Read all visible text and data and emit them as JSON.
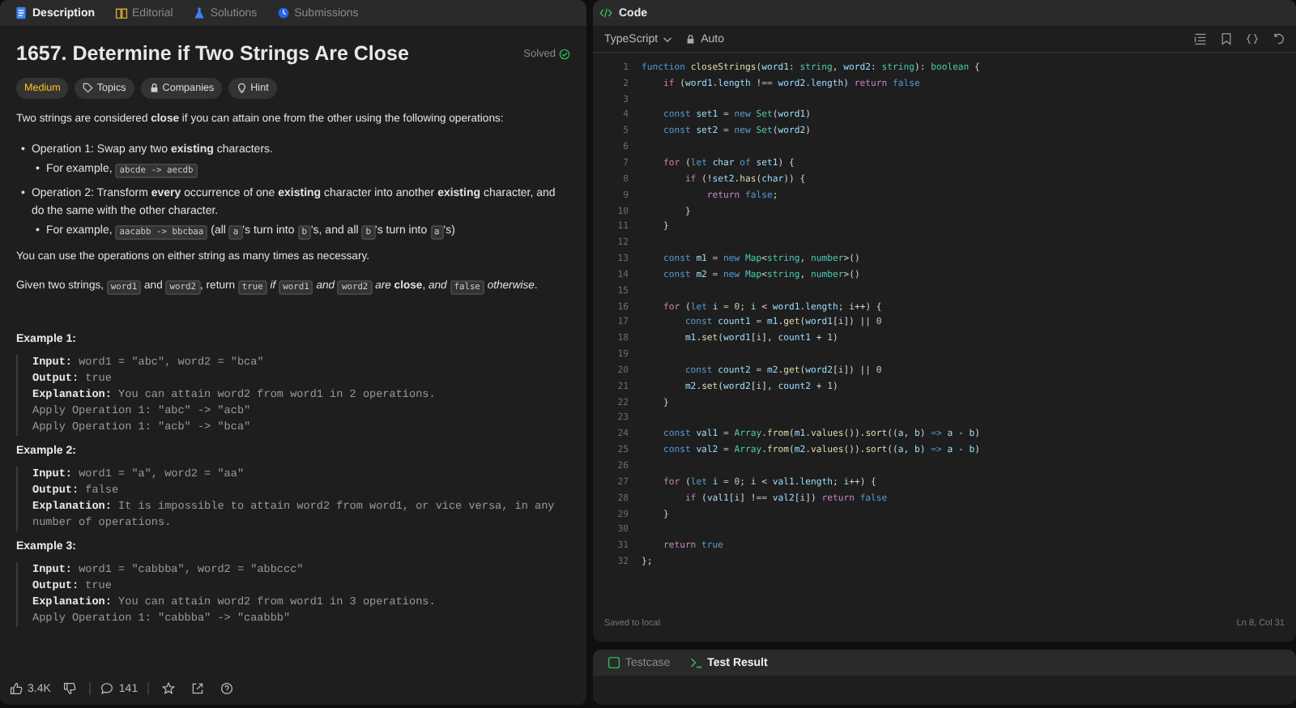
{
  "problem_panel": {
    "tabs": [
      {
        "label": "Description",
        "selected": true,
        "kind": "doc"
      },
      {
        "label": "Editorial",
        "selected": false,
        "kind": "book"
      },
      {
        "label": "Solutions",
        "selected": false,
        "kind": "flask"
      },
      {
        "label": "Submissions",
        "selected": false,
        "kind": "clock"
      }
    ],
    "title": "1657. Determine if Two Strings Are Close",
    "status": "Solved",
    "badges": [
      {
        "label": "Medium",
        "kind": "difficulty"
      },
      {
        "label": "Topics",
        "kind": "tag"
      },
      {
        "label": "Companies",
        "kind": "lock"
      },
      {
        "label": "Hint",
        "kind": "bulb"
      }
    ],
    "description": [
      {
        "kind": "p",
        "segments": [
          {
            "kind": "text",
            "text": "Two strings are considered **close** if you can attain one from the other using the following operations:"
          }
        ]
      },
      {
        "kind": "list",
        "items": [
          {
            "marker": "•",
            "segments": [
              {
                "kind": "text",
                "text": "Operation 1: Swap any two **existing** characters."
              }
            ],
            "sub": [
              {
                "marker": "•",
                "segments": [
                  {
                    "kind": "text",
                    "text": "For example, "
                  },
                  {
                    "kind": "code",
                    "text": "abcde -> aecdb"
                  }
                ]
              }
            ]
          },
          {
            "marker": "•",
            "segments": [
              {
                "kind": "text",
                "text": "Operation 2: Transform **every** occurrence of one **existing** character into another **existing** character, and do the same with the other character."
              }
            ],
            "sub": [
              {
                "marker": "•",
                "segments": [
                  {
                    "kind": "text",
                    "text": "For example, "
                  },
                  {
                    "kind": "code",
                    "text": "aacabb -> bbcbaa"
                  },
                  {
                    "kind": "text",
                    "text": " (all "
                  },
                  {
                    "kind": "code",
                    "text": "a"
                  },
                  {
                    "kind": "text",
                    "text": "'s turn into "
                  },
                  {
                    "kind": "code",
                    "text": "b"
                  },
                  {
                    "kind": "text",
                    "text": "'s, and all "
                  },
                  {
                    "kind": "code",
                    "text": "b"
                  },
                  {
                    "kind": "text",
                    "text": "'s turn into "
                  },
                  {
                    "kind": "code",
                    "text": "a"
                  },
                  {
                    "kind": "text",
                    "text": "'s)"
                  }
                ]
              }
            ]
          }
        ]
      },
      {
        "kind": "p",
        "segments": [
          {
            "kind": "text",
            "text": "You can use the operations on either string as many times as necessary."
          }
        ]
      },
      {
        "kind": "p",
        "segments": [
          {
            "kind": "text",
            "text": "Given two strings, "
          },
          {
            "kind": "code",
            "text": "word1"
          },
          {
            "kind": "text",
            "text": " and "
          },
          {
            "kind": "code",
            "text": "word2"
          },
          {
            "kind": "text",
            "text": ", return "
          },
          {
            "kind": "code",
            "text": "true"
          },
          {
            "kind": "text",
            "text": " *if* "
          },
          {
            "kind": "code",
            "text": "word1"
          },
          {
            "kind": "text",
            "text": " *and* "
          },
          {
            "kind": "code",
            "text": "word2"
          },
          {
            "kind": "text",
            "text": " *are* **close**, *and* "
          },
          {
            "kind": "code",
            "text": "false"
          },
          {
            "kind": "text",
            "text": " *otherwise*."
          }
        ]
      }
    ],
    "examples": [
      {
        "title": "Example 1:",
        "lines": [
          "**Input:** word1 = \"abc\", word2 = \"bca\"",
          "**Output:** true",
          "**Explanation:** You can attain word2 from word1 in 2 operations.",
          "Apply Operation 1: \"abc\" -> \"acb\"",
          "Apply Operation 1: \"acb\" -> \"bca\""
        ]
      },
      {
        "title": "Example 2:",
        "lines": [
          "**Input:** word1 = \"a\", word2 = \"aa\"",
          "**Output:** false",
          "**Explanation:** It is impossible to attain word2 from word1, or vice versa, in any number of operations."
        ]
      },
      {
        "title": "Example 3:",
        "lines": [
          "**Input:** word1 = \"cabbba\", word2 = \"abbccc\"",
          "**Output:** true",
          "**Explanation:** You can attain word2 from word1 in 3 operations.",
          "Apply Operation 1: \"cabbba\" -> \"caabbb\""
        ]
      }
    ],
    "footer": {
      "likes": "3.4K",
      "comments": "141"
    }
  },
  "code_panel": {
    "title": "Code",
    "language": "TypeScript",
    "mode": "Auto",
    "lines": [
      {
        "n": "1",
        "tokens": [
          {
            "text": "function ",
            "kind": "kw"
          },
          {
            "text": "closeStrings",
            "kind": "fn"
          },
          {
            "text": "(",
            "kind": "p"
          },
          {
            "text": "word1",
            "kind": "id"
          },
          {
            "text": ": ",
            "kind": "p"
          },
          {
            "text": "string",
            "kind": "type"
          },
          {
            "text": ", ",
            "kind": "p"
          },
          {
            "text": "word2",
            "kind": "id"
          },
          {
            "text": ": ",
            "kind": "p"
          },
          {
            "text": "string",
            "kind": "type"
          },
          {
            "text": "): ",
            "kind": "p"
          },
          {
            "text": "boolean",
            "kind": "type"
          },
          {
            "text": " {",
            "kind": "p"
          }
        ]
      },
      {
        "n": "2",
        "tokens": [
          {
            "text": "    if",
            "kind": "ctl"
          },
          {
            "text": " (",
            "kind": "p"
          },
          {
            "text": "word1.length",
            "kind": "id"
          },
          {
            "text": " !== ",
            "kind": "p"
          },
          {
            "text": "word2.length",
            "kind": "id"
          },
          {
            "text": ") ",
            "kind": "p"
          },
          {
            "text": "return ",
            "kind": "ctl"
          },
          {
            "text": "false",
            "kind": "kw"
          }
        ]
      },
      {
        "n": "3"
      },
      {
        "n": "4",
        "tokens": [
          {
            "text": "    const ",
            "kind": "kw"
          },
          {
            "text": "set1",
            "kind": "id"
          },
          {
            "text": " = ",
            "kind": "p"
          },
          {
            "text": "new ",
            "kind": "kw"
          },
          {
            "text": "Set",
            "kind": "type"
          },
          {
            "text": "(",
            "kind": "p"
          },
          {
            "text": "word1",
            "kind": "id"
          },
          {
            "text": ")",
            "kind": "p"
          }
        ]
      },
      {
        "n": "5",
        "tokens": [
          {
            "text": "    const ",
            "kind": "kw"
          },
          {
            "text": "set2",
            "kind": "id"
          },
          {
            "text": " = ",
            "kind": "p"
          },
          {
            "text": "new ",
            "kind": "kw"
          },
          {
            "text": "Set",
            "kind": "type"
          },
          {
            "text": "(",
            "kind": "p"
          },
          {
            "text": "word2",
            "kind": "id"
          },
          {
            "text": ")",
            "kind": "p"
          }
        ]
      },
      {
        "n": "6"
      },
      {
        "n": "7",
        "tokens": [
          {
            "text": "    for",
            "kind": "ctl"
          },
          {
            "text": " (",
            "kind": "p"
          },
          {
            "text": "let ",
            "kind": "kw"
          },
          {
            "text": "char",
            "kind": "id"
          },
          {
            "text": " of ",
            "kind": "kw"
          },
          {
            "text": "set1",
            "kind": "id"
          },
          {
            "text": ") {",
            "kind": "p"
          }
        ]
      },
      {
        "n": "8",
        "tokens": [
          {
            "text": "        if",
            "kind": "ctl"
          },
          {
            "text": " (!",
            "kind": "p"
          },
          {
            "text": "set2",
            "kind": "id"
          },
          {
            "text": ".",
            "kind": "p"
          },
          {
            "text": "has",
            "kind": "fn"
          },
          {
            "text": "(",
            "kind": "p"
          },
          {
            "text": "char",
            "kind": "id"
          },
          {
            "text": ")) {",
            "kind": "p"
          }
        ]
      },
      {
        "n": "9",
        "tokens": [
          {
            "text": "            return ",
            "kind": "ctl"
          },
          {
            "text": "false",
            "kind": "kw"
          },
          {
            "text": ";",
            "kind": "p"
          }
        ]
      },
      {
        "n": "10",
        "tokens": [
          {
            "text": "        }",
            "kind": "p"
          }
        ]
      },
      {
        "n": "11",
        "tokens": [
          {
            "text": "    }",
            "kind": "p"
          }
        ]
      },
      {
        "n": "12"
      },
      {
        "n": "13",
        "tokens": [
          {
            "text": "    const ",
            "kind": "kw"
          },
          {
            "text": "m1",
            "kind": "id"
          },
          {
            "text": " = ",
            "kind": "p"
          },
          {
            "text": "new ",
            "kind": "kw"
          },
          {
            "text": "Map",
            "kind": "type"
          },
          {
            "text": "<",
            "kind": "p"
          },
          {
            "text": "string",
            "kind": "type"
          },
          {
            "text": ", ",
            "kind": "p"
          },
          {
            "text": "number",
            "kind": "type"
          },
          {
            "text": ">()",
            "kind": "p"
          }
        ]
      },
      {
        "n": "14",
        "tokens": [
          {
            "text": "    const ",
            "kind": "kw"
          },
          {
            "text": "m2",
            "kind": "id"
          },
          {
            "text": " = ",
            "kind": "p"
          },
          {
            "text": "new ",
            "kind": "kw"
          },
          {
            "text": "Map",
            "kind": "type"
          },
          {
            "text": "<",
            "kind": "p"
          },
          {
            "text": "string",
            "kind": "type"
          },
          {
            "text": ", ",
            "kind": "p"
          },
          {
            "text": "number",
            "kind": "type"
          },
          {
            "text": ">()",
            "kind": "p"
          }
        ]
      },
      {
        "n": "15"
      },
      {
        "n": "16",
        "tokens": [
          {
            "text": "    for",
            "kind": "ctl"
          },
          {
            "text": " (",
            "kind": "p"
          },
          {
            "text": "let ",
            "kind": "kw"
          },
          {
            "text": "i",
            "kind": "id"
          },
          {
            "text": " = ",
            "kind": "p"
          },
          {
            "text": "0",
            "kind": "num"
          },
          {
            "text": "; ",
            "kind": "p"
          },
          {
            "text": "i",
            "kind": "id"
          },
          {
            "text": " < ",
            "kind": "p"
          },
          {
            "text": "word1.length",
            "kind": "id"
          },
          {
            "text": "; ",
            "kind": "p"
          },
          {
            "text": "i",
            "kind": "id"
          },
          {
            "text": "++) {",
            "kind": "p"
          }
        ]
      },
      {
        "n": "17",
        "tokens": [
          {
            "text": "        const ",
            "kind": "kw"
          },
          {
            "text": "count1",
            "kind": "id"
          },
          {
            "text": " = ",
            "kind": "p"
          },
          {
            "text": "m1",
            "kind": "id"
          },
          {
            "text": ".",
            "kind": "p"
          },
          {
            "text": "get",
            "kind": "fn"
          },
          {
            "text": "(",
            "kind": "p"
          },
          {
            "text": "word1",
            "kind": "id"
          },
          {
            "text": "[",
            "kind": "p"
          },
          {
            "text": "i",
            "kind": "id"
          },
          {
            "text": "]) || ",
            "kind": "p"
          },
          {
            "text": "0",
            "kind": "num"
          }
        ]
      },
      {
        "n": "18",
        "tokens": [
          {
            "text": "        m1",
            "kind": "id"
          },
          {
            "text": ".",
            "kind": "p"
          },
          {
            "text": "set",
            "kind": "fn"
          },
          {
            "text": "(",
            "kind": "p"
          },
          {
            "text": "word1",
            "kind": "id"
          },
          {
            "text": "[",
            "kind": "p"
          },
          {
            "text": "i",
            "kind": "id"
          },
          {
            "text": "], ",
            "kind": "p"
          },
          {
            "text": "count1",
            "kind": "id"
          },
          {
            "text": " + ",
            "kind": "p"
          },
          {
            "text": "1",
            "kind": "num"
          },
          {
            "text": ")",
            "kind": "p"
          }
        ]
      },
      {
        "n": "19"
      },
      {
        "n": "20",
        "tokens": [
          {
            "text": "        const ",
            "kind": "kw"
          },
          {
            "text": "count2",
            "kind": "id"
          },
          {
            "text": " = ",
            "kind": "p"
          },
          {
            "text": "m2",
            "kind": "id"
          },
          {
            "text": ".",
            "kind": "p"
          },
          {
            "text": "get",
            "kind": "fn"
          },
          {
            "text": "(",
            "kind": "p"
          },
          {
            "text": "word2",
            "kind": "id"
          },
          {
            "text": "[",
            "kind": "p"
          },
          {
            "text": "i",
            "kind": "id"
          },
          {
            "text": "]) || ",
            "kind": "p"
          },
          {
            "text": "0",
            "kind": "num"
          }
        ]
      },
      {
        "n": "21",
        "tokens": [
          {
            "text": "        m2",
            "kind": "id"
          },
          {
            "text": ".",
            "kind": "p"
          },
          {
            "text": "set",
            "kind": "fn"
          },
          {
            "text": "(",
            "kind": "p"
          },
          {
            "text": "word2",
            "kind": "id"
          },
          {
            "text": "[",
            "kind": "p"
          },
          {
            "text": "i",
            "kind": "id"
          },
          {
            "text": "], ",
            "kind": "p"
          },
          {
            "text": "count2",
            "kind": "id"
          },
          {
            "text": " + ",
            "kind": "p"
          },
          {
            "text": "1",
            "kind": "num"
          },
          {
            "text": ")",
            "kind": "p"
          }
        ]
      },
      {
        "n": "22",
        "tokens": [
          {
            "text": "    }",
            "kind": "p"
          }
        ]
      },
      {
        "n": "23"
      },
      {
        "n": "24",
        "tokens": [
          {
            "text": "    const ",
            "kind": "kw"
          },
          {
            "text": "val1",
            "kind": "id"
          },
          {
            "text": " = ",
            "kind": "p"
          },
          {
            "text": "Array",
            "kind": "type"
          },
          {
            "text": ".",
            "kind": "p"
          },
          {
            "text": "from",
            "kind": "fn"
          },
          {
            "text": "(",
            "kind": "p"
          },
          {
            "text": "m1",
            "kind": "id"
          },
          {
            "text": ".",
            "kind": "p"
          },
          {
            "text": "values",
            "kind": "fn"
          },
          {
            "text": "()).",
            "kind": "p"
          },
          {
            "text": "sort",
            "kind": "fn"
          },
          {
            "text": "((",
            "kind": "p"
          },
          {
            "text": "a",
            "kind": "id"
          },
          {
            "text": ", ",
            "kind": "p"
          },
          {
            "text": "b",
            "kind": "id"
          },
          {
            "text": ") ",
            "kind": "p"
          },
          {
            "text": "=> ",
            "kind": "kw"
          },
          {
            "text": "a",
            "kind": "id"
          },
          {
            "text": " - ",
            "kind": "p"
          },
          {
            "text": "b",
            "kind": "id"
          },
          {
            "text": ")",
            "kind": "p"
          }
        ]
      },
      {
        "n": "25",
        "tokens": [
          {
            "text": "    const ",
            "kind": "kw"
          },
          {
            "text": "val2",
            "kind": "id"
          },
          {
            "text": " = ",
            "kind": "p"
          },
          {
            "text": "Array",
            "kind": "type"
          },
          {
            "text": ".",
            "kind": "p"
          },
          {
            "text": "from",
            "kind": "fn"
          },
          {
            "text": "(",
            "kind": "p"
          },
          {
            "text": "m2",
            "kind": "id"
          },
          {
            "text": ".",
            "kind": "p"
          },
          {
            "text": "values",
            "kind": "fn"
          },
          {
            "text": "()).",
            "kind": "p"
          },
          {
            "text": "sort",
            "kind": "fn"
          },
          {
            "text": "((",
            "kind": "p"
          },
          {
            "text": "a",
            "kind": "id"
          },
          {
            "text": ", ",
            "kind": "p"
          },
          {
            "text": "b",
            "kind": "id"
          },
          {
            "text": ") ",
            "kind": "p"
          },
          {
            "text": "=> ",
            "kind": "kw"
          },
          {
            "text": "a",
            "kind": "id"
          },
          {
            "text": " - ",
            "kind": "p"
          },
          {
            "text": "b",
            "kind": "id"
          },
          {
            "text": ")",
            "kind": "p"
          }
        ]
      },
      {
        "n": "26"
      },
      {
        "n": "27",
        "tokens": [
          {
            "text": "    for",
            "kind": "ctl"
          },
          {
            "text": " (",
            "kind": "p"
          },
          {
            "text": "let ",
            "kind": "kw"
          },
          {
            "text": "i",
            "kind": "id"
          },
          {
            "text": " = ",
            "kind": "p"
          },
          {
            "text": "0",
            "kind": "num"
          },
          {
            "text": "; ",
            "kind": "p"
          },
          {
            "text": "i",
            "kind": "id"
          },
          {
            "text": " < ",
            "kind": "p"
          },
          {
            "text": "val1.length",
            "kind": "id"
          },
          {
            "text": "; ",
            "kind": "p"
          },
          {
            "text": "i",
            "kind": "id"
          },
          {
            "text": "++) {",
            "kind": "p"
          }
        ]
      },
      {
        "n": "28",
        "tokens": [
          {
            "text": "        if",
            "kind": "ctl"
          },
          {
            "text": " (",
            "kind": "p"
          },
          {
            "text": "val1",
            "kind": "id"
          },
          {
            "text": "[",
            "kind": "p"
          },
          {
            "text": "i",
            "kind": "id"
          },
          {
            "text": "] !== ",
            "kind": "p"
          },
          {
            "text": "val2",
            "kind": "id"
          },
          {
            "text": "[",
            "kind": "p"
          },
          {
            "text": "i",
            "kind": "id"
          },
          {
            "text": "]) ",
            "kind": "p"
          },
          {
            "text": "return ",
            "kind": "ctl"
          },
          {
            "text": "false",
            "kind": "kw"
          }
        ]
      },
      {
        "n": "29",
        "tokens": [
          {
            "text": "    }",
            "kind": "p"
          }
        ]
      },
      {
        "n": "30"
      },
      {
        "n": "31",
        "tokens": [
          {
            "text": "    return ",
            "kind": "ctl"
          },
          {
            "text": "true",
            "kind": "kw"
          }
        ]
      },
      {
        "n": "32",
        "tokens": [
          {
            "text": "};",
            "kind": "p"
          }
        ]
      }
    ],
    "saved_status": "Saved to local",
    "cursor": "Ln 8, Col 31"
  },
  "result_panel": {
    "tabs": [
      {
        "label": "Testcase",
        "selected": false,
        "kind": "check"
      },
      {
        "label": "Test Result",
        "selected": true,
        "kind": "terminal"
      }
    ]
  }
}
